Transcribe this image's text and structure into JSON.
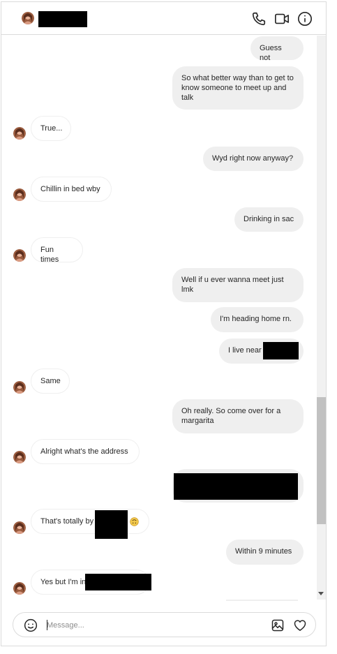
{
  "header": {
    "icons": [
      "phone-icon",
      "video-camera-icon",
      "info-icon"
    ]
  },
  "messages": [
    {
      "from": "me",
      "text": "Guess not"
    },
    {
      "from": "me",
      "text": "So what better way than to get to know someone to meet up and talk"
    },
    {
      "from": "them",
      "text": "True..."
    },
    {
      "from": "me",
      "text": "Wyd right now anyway?"
    },
    {
      "from": "them",
      "text": "Chillin in bed wby"
    },
    {
      "from": "me",
      "text": "Drinking in sac"
    },
    {
      "from": "them",
      "text": "Fun times"
    },
    {
      "from": "me",
      "text": "Well if u ever wanna meet just lmk"
    },
    {
      "from": "me",
      "text": "I'm heading home rn."
    },
    {
      "from": "me",
      "text": "I live near"
    },
    {
      "from": "them",
      "text": "Same"
    },
    {
      "from": "me",
      "text": "Oh really. So come over for a margarita"
    },
    {
      "from": "them",
      "text": "Alright what's the address"
    },
    {
      "from": "me",
      "text": ""
    },
    {
      "from": "them",
      "text": "That's totally by"
    },
    {
      "from": "me",
      "text": "Within 9 minutes"
    },
    {
      "from": "them",
      "text": "Yes but I'm in"
    }
  ],
  "composer": {
    "placeholder": "Message...",
    "icons": [
      "emoji-icon",
      "image-icon",
      "heart-icon"
    ]
  },
  "colors": {
    "outgoing_bubble": "#efefef",
    "border": "#dbdbdb",
    "text": "#262626",
    "emoji": "#e8b93a"
  }
}
